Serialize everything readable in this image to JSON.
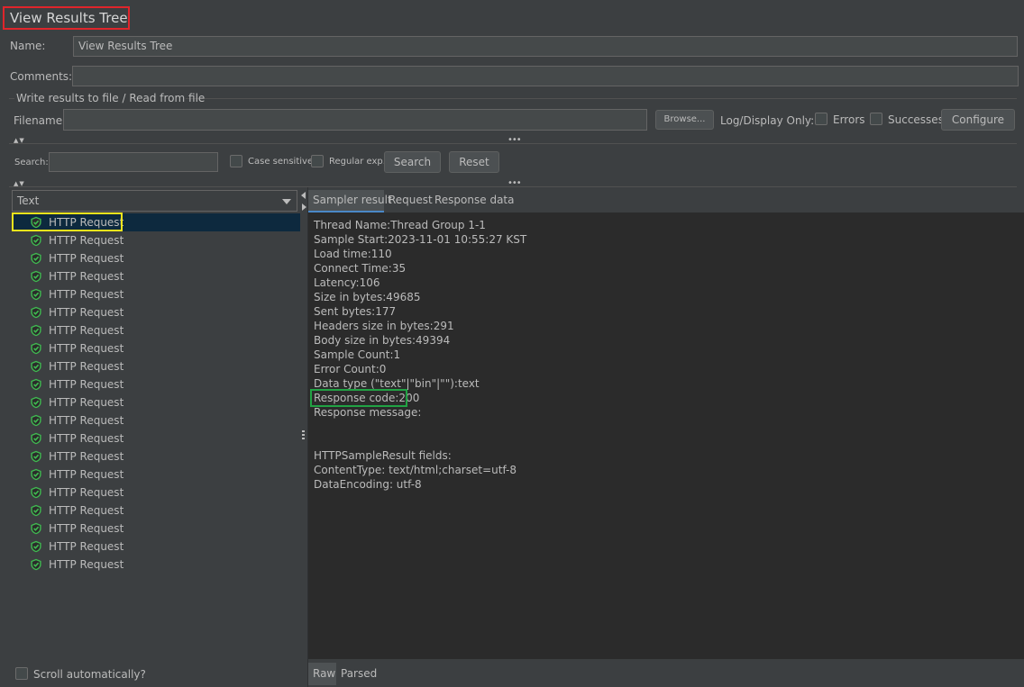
{
  "title": "View Results Tree",
  "name": {
    "label": "Name:",
    "value": "View Results Tree"
  },
  "comments": {
    "label": "Comments:",
    "value": ""
  },
  "file_section": {
    "legend": "Write results to file / Read from file",
    "filename_label": "Filename",
    "filename_value": "",
    "browse_label": "Browse...",
    "log_display_label": "Log/Display Only:",
    "errors_label": "Errors",
    "successes_label": "Successes",
    "configure_label": "Configure"
  },
  "search": {
    "label": "Search:",
    "value": "",
    "case_sensitive_label": "Case sensitive",
    "regular_exp_label": "Regular exp.",
    "search_button": "Search",
    "reset_button": "Reset"
  },
  "renderer": {
    "selected": "Text"
  },
  "tree": {
    "items": [
      "HTTP Request",
      "HTTP Request",
      "HTTP Request",
      "HTTP Request",
      "HTTP Request",
      "HTTP Request",
      "HTTP Request",
      "HTTP Request",
      "HTTP Request",
      "HTTP Request",
      "HTTP Request",
      "HTTP Request",
      "HTTP Request",
      "HTTP Request",
      "HTTP Request",
      "HTTP Request",
      "HTTP Request",
      "HTTP Request",
      "HTTP Request",
      "HTTP Request"
    ],
    "selected_index": 0,
    "status_color": "#3fb950",
    "icon": "shield-check-icon"
  },
  "scroll_auto_label": "Scroll automatically?",
  "result_tabs": [
    "Sampler result",
    "Request",
    "Response data"
  ],
  "active_result_tab": "Sampler result",
  "sampler_result": [
    "Thread Name:Thread Group 1-1",
    "Sample Start:2023-11-01 10:55:27 KST",
    "Load time:110",
    "Connect Time:35",
    "Latency:106",
    "Size in bytes:49685",
    "Sent bytes:177",
    "Headers size in bytes:291",
    "Body size in bytes:49394",
    "Sample Count:1",
    "Error Count:0",
    "Data type (\"text\"|\"bin\"|\"\"):text",
    "Response code:200",
    "Response message:",
    "",
    "",
    "HTTPSampleResult fields:",
    "ContentType: text/html;charset=utf-8",
    "DataEncoding: utf-8"
  ],
  "bottom_tabs": [
    "Raw",
    "Parsed"
  ],
  "active_bottom_tab": "Raw",
  "highlight_colors": {
    "title": "#e0252b",
    "selected_item": "#f2e41c",
    "response_code": "#21a244"
  }
}
